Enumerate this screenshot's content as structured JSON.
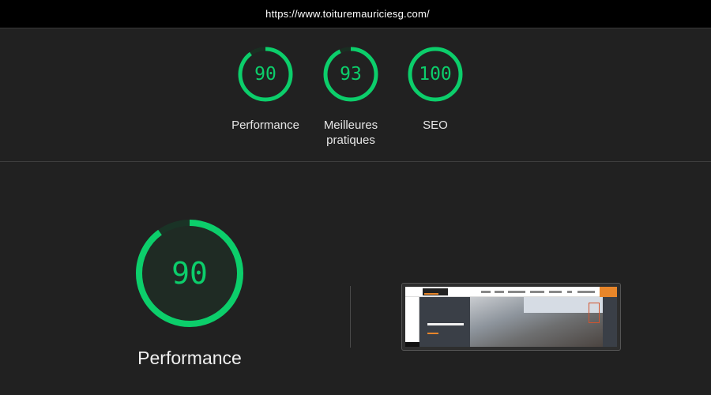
{
  "url_bar": {
    "url": "https://www.toiturem​auriciesg.com/"
  },
  "summary": {
    "gauges": [
      {
        "score": "90",
        "label_line1": "Performance",
        "label_line2": "",
        "fraction": 0.9
      },
      {
        "score": "93",
        "label_line1": "Meilleures",
        "label_line2": "pratiques",
        "fraction": 0.93
      },
      {
        "score": "100",
        "label_line1": "SEO",
        "label_line2": "",
        "fraction": 1.0
      }
    ]
  },
  "detail": {
    "gauge": {
      "score": "90",
      "label": "Performance",
      "fraction": 0.9
    },
    "screenshot": {
      "alt": "page screenshot"
    }
  },
  "colors": {
    "pass_green": "#0cce6b",
    "gauge_track": "#1f3a2a",
    "background": "#212121"
  }
}
